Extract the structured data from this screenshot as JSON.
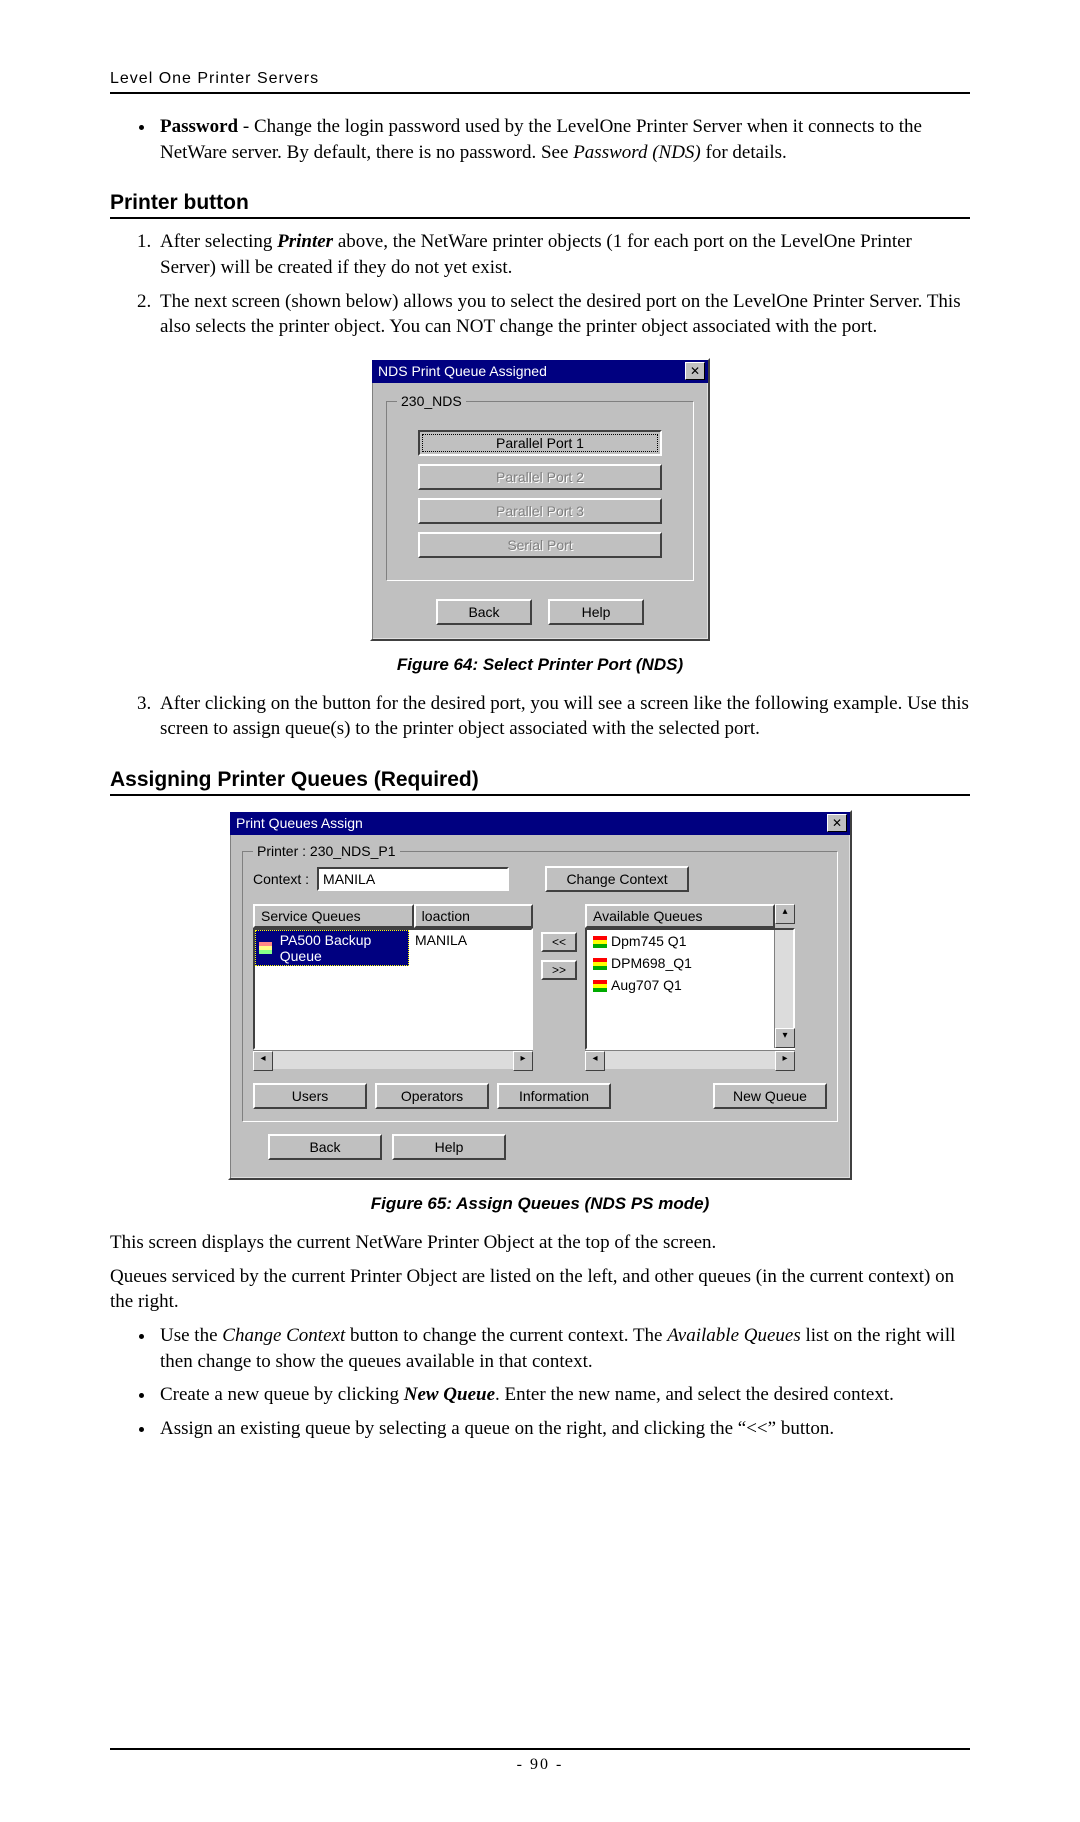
{
  "header": {
    "running": "Level One Printer Servers"
  },
  "intro_bullet": {
    "label": "Password",
    "text_after_label": " - Change the login password used by the LevelOne Printer Server when it connects to the NetWare server. By default, there is no password. See ",
    "italic_ref": "Password (NDS)",
    "text_tail": " for details."
  },
  "section1": {
    "heading": "Printer button",
    "step1_pre": "After selecting ",
    "step1_bi": "Printer",
    "step1_post": " above, the NetWare printer objects (1 for each port on the LevelOne Printer Server) will be created if they do not yet exist.",
    "step2": "The next screen (shown below) allows you to select the desired port on the LevelOne Printer Server. This also selects the printer object. You can NOT change the printer object associated with the port."
  },
  "dlg1": {
    "title": "NDS Print Queue Assigned",
    "group_legend": "230_NDS",
    "buttons": {
      "port1": "Parallel Port 1",
      "port2": "Parallel Port 2",
      "port3": "Parallel Port 3",
      "serial": "Serial Port",
      "back": "Back",
      "help": "Help"
    }
  },
  "fig1_caption": "Figure 64: Select Printer Port (NDS)",
  "step3": "After clicking on the button for the desired port, you will see a screen like the following example. Use this screen to assign queue(s) to the printer object associated with the selected port.",
  "section2_heading": "Assigning Printer Queues (Required)",
  "dlg2": {
    "title": "Print Queues Assign",
    "group_legend": "Printer : 230_NDS_P1",
    "context_label": "Context :",
    "context_value": "MANILA",
    "change_context": "Change Context",
    "headers": {
      "svc": "Service Queues",
      "loc": "loaction",
      "avail": "Available Queues"
    },
    "svc_item": {
      "name": "PA500 Backup Queue",
      "loc": "MANILA"
    },
    "xfer_left": "<<",
    "xfer_right": ">>",
    "avail_items": [
      "Dpm745 Q1",
      "DPM698_Q1",
      "Aug707 Q1"
    ],
    "buttons": {
      "users": "Users",
      "operators": "Operators",
      "information": "Information",
      "newqueue": "New Queue",
      "back": "Back",
      "help": "Help"
    }
  },
  "fig2_caption": "Figure 65: Assign Queues (NDS PS mode)",
  "para1": "This screen displays the current NetWare Printer Object at the top of the screen.",
  "para2": "Queues serviced by the current Printer Object are listed on the left, and other queues (in the current context) on the right.",
  "b1_pre": "Use the ",
  "b1_i1": "Change Context",
  "b1_mid": " button to change the current context. The ",
  "b1_i2": "Available Queues",
  "b1_post": " list on the right will then change to show the queues available in that context.",
  "b2_pre": "Create a new queue by clicking ",
  "b2_bi": "New Queue",
  "b2_post": ". Enter the new name, and select the desired context.",
  "b3": "Assign an existing queue by selecting a queue on the right, and clicking the “<<” button.",
  "footer": {
    "page": "-  90  -"
  }
}
